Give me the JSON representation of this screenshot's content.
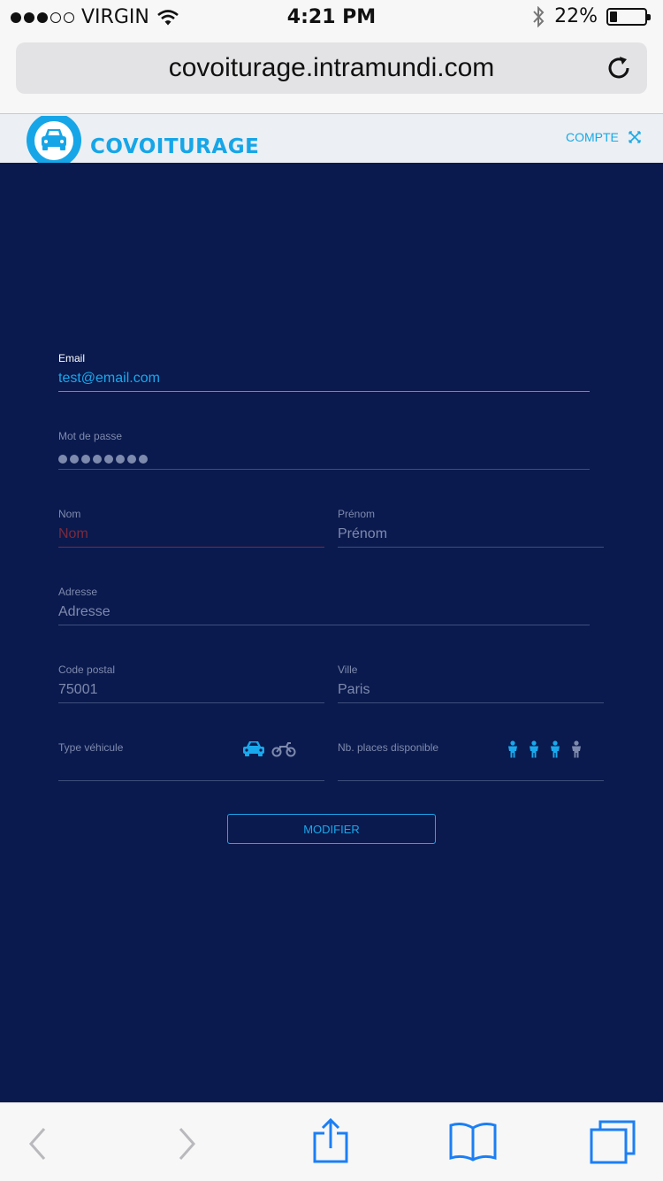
{
  "statusbar": {
    "carrier": "VIRGIN",
    "time": "4:21 PM",
    "battery": "22%",
    "battery_level": 0.22
  },
  "browser": {
    "url": "covoiturage.intramundi.com"
  },
  "site": {
    "brand": "COVOITURAGE",
    "account_label": "COMPTE"
  },
  "form": {
    "email": {
      "label": "Email",
      "value": "test@email.com"
    },
    "password": {
      "label": "Mot de passe",
      "dot_count": 8
    },
    "nom": {
      "label": "Nom",
      "placeholder": "Nom"
    },
    "prenom": {
      "label": "Prénom",
      "placeholder": "Prénom"
    },
    "adresse": {
      "label": "Adresse",
      "placeholder": "Adresse"
    },
    "code_postal": {
      "label": "Code postal",
      "placeholder": "75001"
    },
    "ville": {
      "label": "Ville",
      "placeholder": "Paris"
    },
    "vehicule": {
      "label": "Type véhicule",
      "options": [
        "car-icon",
        "motorcycle-icon"
      ],
      "selected": "car-icon"
    },
    "places": {
      "label": "Nb. places disponible",
      "max": 4,
      "selected": 3
    },
    "submit_label": "MODIFIER"
  },
  "colors": {
    "accent": "#1aa8ec",
    "background": "#0a1a4e",
    "muted": "#7e8aad",
    "error": "#7a2a3c"
  }
}
